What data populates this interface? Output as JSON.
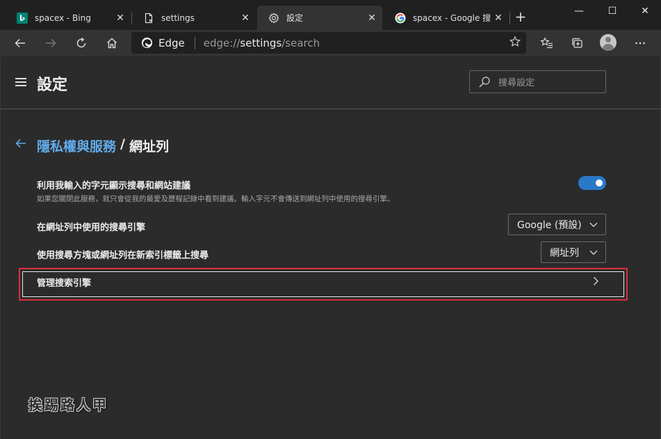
{
  "tabs": [
    {
      "title": "spacex - Bing",
      "favicon": "bing-icon",
      "active": false
    },
    {
      "title": "settings",
      "favicon": "file-icon",
      "active": false
    },
    {
      "title": "設定",
      "favicon": "gear-icon",
      "active": true
    },
    {
      "title": "spacex - Google 搜尋",
      "favicon": "google-icon",
      "active": false
    }
  ],
  "tab_close_glyph": "✕",
  "new_tab_glyph": "+",
  "window_controls": {
    "minimize": "—",
    "maximize": "☐",
    "close": "✕"
  },
  "omnibox": {
    "brand": "Edge",
    "url_scheme": "edge://",
    "url_host": "settings",
    "url_path": "/search"
  },
  "settings": {
    "page_title": "設定",
    "search_placeholder": "搜尋設定",
    "breadcrumb": {
      "parent": "隱私權與服務",
      "separator": "/",
      "current": "網址列"
    },
    "suggestions": {
      "label": "利用我輸入的字元顯示搜尋和網站建議",
      "description": "如果您關閉此服務，就只會從我的最愛及歷程記錄中看到建議。輸入字元不會傳送到網址列中使用的搜尋引擎。",
      "enabled": true
    },
    "engine": {
      "label": "在網址列中使用的搜尋引擎",
      "value": "Google (預設)"
    },
    "new_tab_search": {
      "label": "使用搜尋方塊或網址列在新索引標籤上搜尋",
      "value": "網址列"
    },
    "manage": {
      "label": "管理搜索引擎"
    }
  },
  "watermark": "挨踢路人甲",
  "colors": {
    "accent": "#2a78c8",
    "link": "#62abea",
    "highlight": "#d8303a"
  }
}
